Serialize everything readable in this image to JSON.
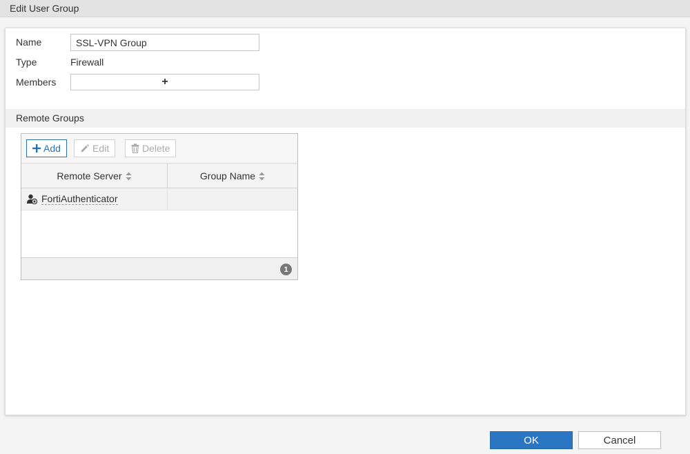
{
  "dialog": {
    "title": "Edit User Group"
  },
  "form": {
    "name_label": "Name",
    "name_value": "SSL-VPN Group",
    "type_label": "Type",
    "type_value": "Firewall",
    "members_label": "Members",
    "members_add_glyph": "+"
  },
  "remote_groups": {
    "title": "Remote Groups",
    "toolbar": {
      "add_label": "Add",
      "edit_label": "Edit",
      "delete_label": "Delete"
    },
    "columns": [
      "Remote Server",
      "Group Name"
    ],
    "rows": [
      {
        "remote_server": "FortiAuthenticator",
        "group_name": ""
      }
    ],
    "count": "1"
  },
  "actions": {
    "ok_label": "OK",
    "cancel_label": "Cancel"
  },
  "colors": {
    "primary": "#2b76c3",
    "border": "#c6c6c6",
    "header_bg": "#e3e3e3"
  }
}
